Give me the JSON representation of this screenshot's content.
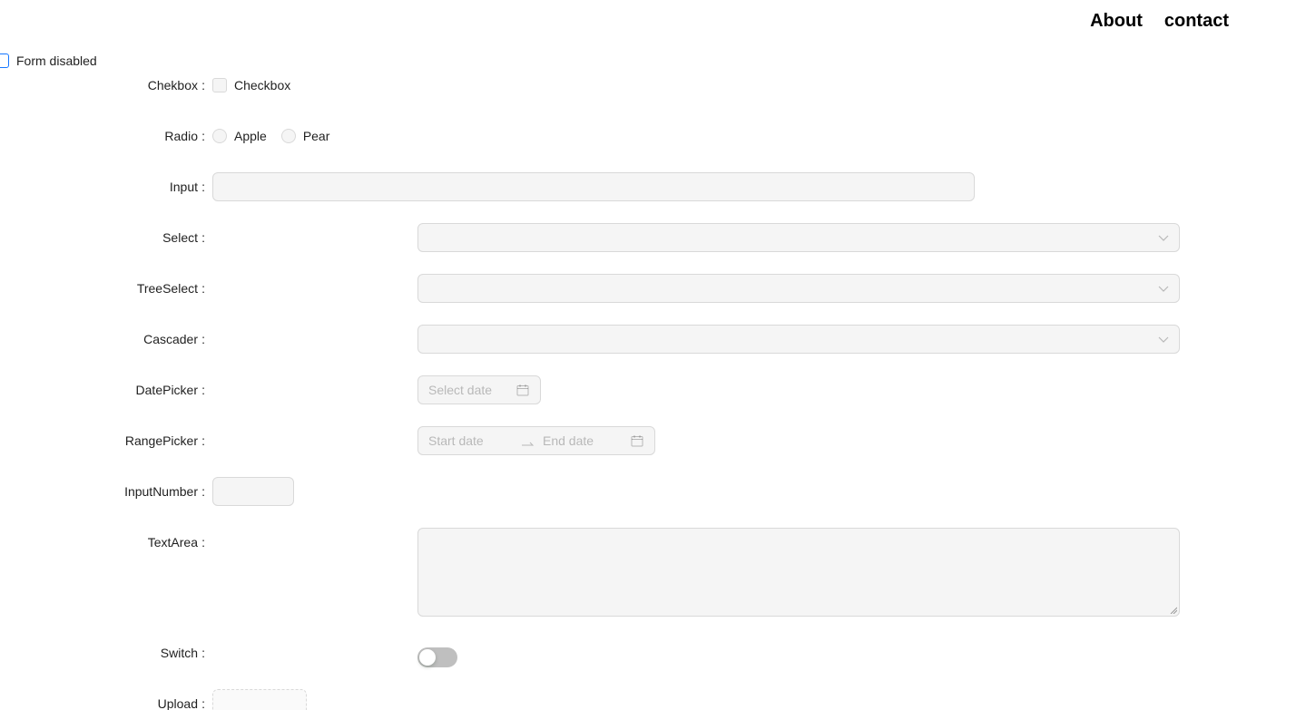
{
  "nav": {
    "about": "About",
    "contact": "contact"
  },
  "form_disabled": {
    "label": "Form disabled",
    "checked": false
  },
  "fields": {
    "checkbox": {
      "label": "Chekbox",
      "option": "Checkbox"
    },
    "radio": {
      "label": "Radio",
      "options": [
        "Apple",
        "Pear"
      ]
    },
    "input": {
      "label": "Input",
      "value": ""
    },
    "select": {
      "label": "Select",
      "value": ""
    },
    "treeselect": {
      "label": "TreeSelect",
      "value": ""
    },
    "cascader": {
      "label": "Cascader",
      "value": ""
    },
    "datepicker": {
      "label": "DatePicker",
      "placeholder": "Select date"
    },
    "rangepicker": {
      "label": "RangePicker",
      "start_placeholder": "Start date",
      "end_placeholder": "End date"
    },
    "inputnumber": {
      "label": "InputNumber",
      "value": ""
    },
    "textarea": {
      "label": "TextArea",
      "value": ""
    },
    "switch": {
      "label": "Switch",
      "on": false
    },
    "upload": {
      "label": "Upload"
    }
  },
  "colors": {
    "border": "#d9d9d9",
    "accent": "#1677ff",
    "placeholder": "rgba(0,0,0,0.25)"
  },
  "icons": {
    "select_arrow": "chevron-down-icon",
    "date": "calendar-icon",
    "range_separator": "swap-right-icon"
  }
}
